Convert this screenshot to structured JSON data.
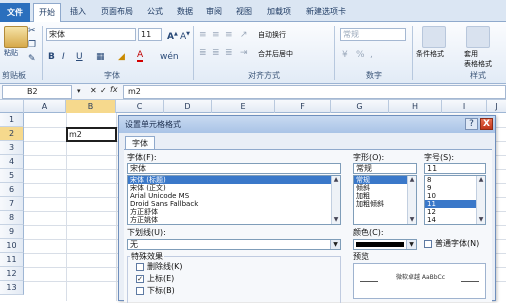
{
  "ribbon_tabs": {
    "file": "文件",
    "home": "开始",
    "insert": "插入",
    "page_layout": "页面布局",
    "formulas": "公式",
    "data": "数据",
    "review": "审阅",
    "view": "视图",
    "addins": "加载项",
    "new_tab": "新建选项卡"
  },
  "ribbon": {
    "clipboard": {
      "paste_label": "粘贴",
      "group_label": "剪贴板"
    },
    "font": {
      "font_name": "宋体",
      "font_size": "11",
      "group_label": "字体"
    },
    "alignment": {
      "wrap_text": "自动换行",
      "merge_center": "合并后居中",
      "group_label": "对齐方式"
    },
    "number": {
      "format": "常规",
      "percent": "%",
      "comma": ",",
      "group_label": "数字"
    },
    "styles": {
      "conditional": "条件格式",
      "table_format": "套用\n表格格式",
      "group_label": "样式"
    }
  },
  "formula_bar": {
    "name_box": "B2",
    "fx": "fx",
    "content": "m2"
  },
  "grid": {
    "columns": [
      "A",
      "B",
      "C",
      "D",
      "E",
      "F",
      "G",
      "H",
      "I",
      "J"
    ],
    "rows": [
      "1",
      "2",
      "3",
      "4",
      "5",
      "6",
      "7",
      "8",
      "9",
      "10",
      "11",
      "12",
      "13"
    ],
    "cell_b2": "m2"
  },
  "dialog": {
    "title": "设置单元格格式",
    "help": "?",
    "close": "X",
    "tab_font": "字体",
    "font_label": "字体(F):",
    "font_value": "宋体",
    "font_list": [
      "宋体 (标题)",
      "宋体 (正文)",
      "Arial Unicode MS",
      "Droid Sans Fallback",
      "方正舒体",
      "方正姚体"
    ],
    "style_label": "字形(O):",
    "style_value": "常规",
    "style_list": [
      "常规",
      "倾斜",
      "加粗",
      "加粗倾斜"
    ],
    "size_label": "字号(S):",
    "size_value": "11",
    "size_list": [
      "8",
      "9",
      "10",
      "11",
      "12",
      "14"
    ],
    "underline_label": "下划线(U):",
    "underline_value": "无",
    "color_label": "颜色(C):",
    "normal_font_label": "普通字体(N)",
    "effects_label": "特殊效果",
    "strike_label": "删除线(K)",
    "superscript_label": "上标(E)",
    "subscript_label": "下标(B)",
    "preview_label": "预览",
    "preview_text": "微软卓越  AaBbCc"
  }
}
